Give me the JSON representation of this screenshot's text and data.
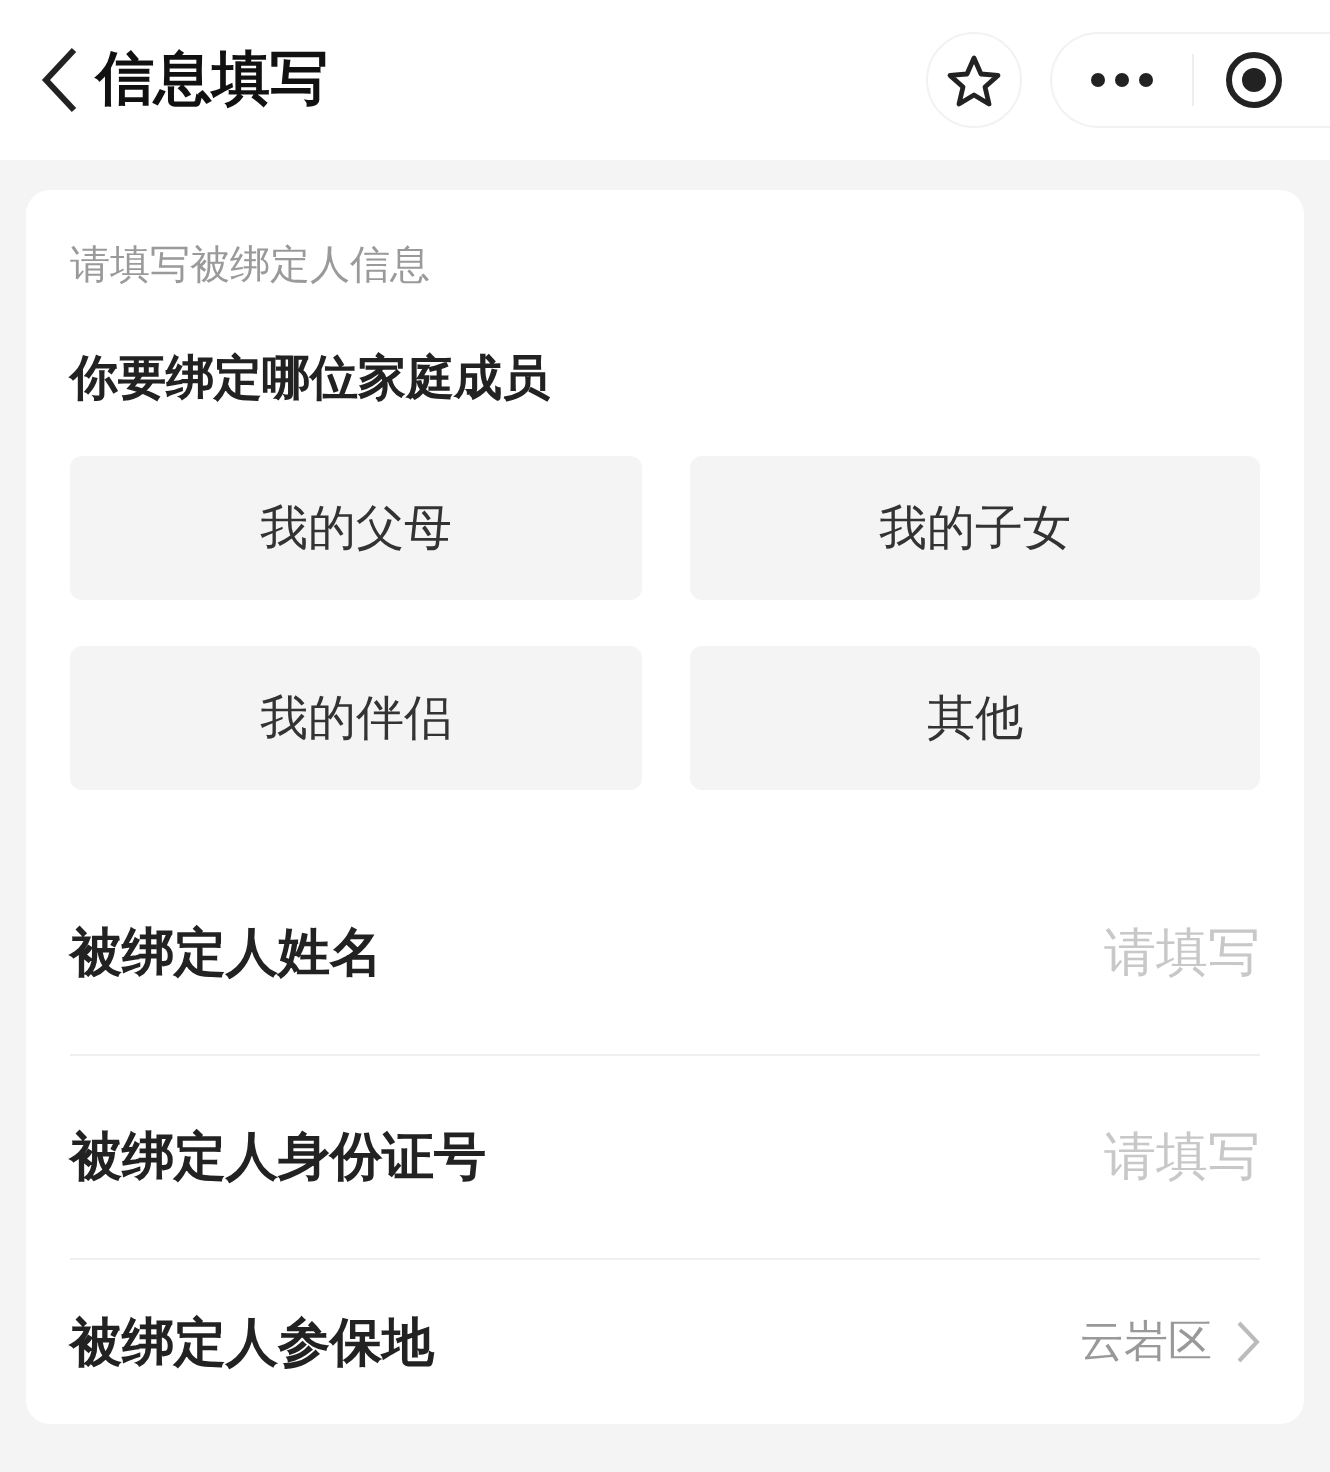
{
  "header": {
    "title": "信息填写"
  },
  "card": {
    "subtitle": "请填写被绑定人信息",
    "question": "你要绑定哪位家庭成员",
    "options": [
      {
        "label": "我的父母",
        "selected": false
      },
      {
        "label": "我的子女",
        "selected": false
      },
      {
        "label": "我的伴侣",
        "selected": false
      },
      {
        "label": "其他",
        "selected": false
      }
    ],
    "fields": [
      {
        "kind": "text",
        "label": "被绑定人姓名",
        "placeholder": "请填写"
      },
      {
        "kind": "text",
        "label": "被绑定人身份证号",
        "placeholder": "请填写"
      },
      {
        "kind": "picker",
        "label": "被绑定人参保地",
        "value": "云岩区"
      }
    ]
  }
}
